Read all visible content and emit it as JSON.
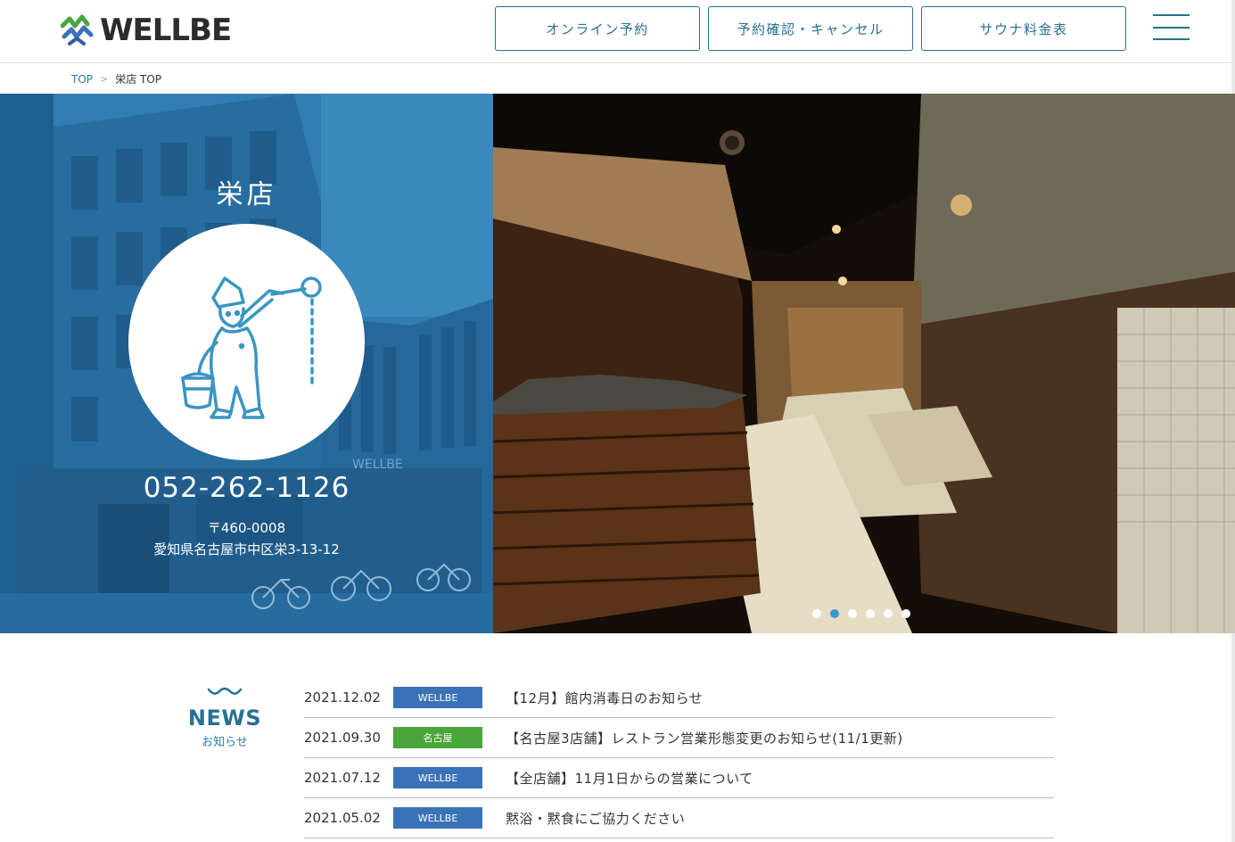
{
  "header": {
    "logo_text": "WELLBE",
    "buttons": [
      "オンライン予約",
      "予約確認・キャンセル",
      "サウナ料金表"
    ]
  },
  "breadcrumb": {
    "home": "TOP",
    "separator": ">",
    "current": "栄店 TOP"
  },
  "store": {
    "name": "栄店",
    "phone": "052-262-1126",
    "postal": "〒460-0008",
    "address": "愛知県名古屋市中区栄3-13-12",
    "building_sign": "WELLBE"
  },
  "slider": {
    "dot_count": 6,
    "active_index": 1
  },
  "news": {
    "title": "NEWS",
    "subtitle": "お知らせ",
    "items": [
      {
        "date": "2021.12.02",
        "tag": "WELLBE",
        "tag_type": "wellbe",
        "text": "【12月】館内消毒日のお知らせ"
      },
      {
        "date": "2021.09.30",
        "tag": "名古屋",
        "tag_type": "nagoya",
        "text": "【名古屋3店舗】レストラン営業形態変更のお知らせ(11/1更新)"
      },
      {
        "date": "2021.07.12",
        "tag": "WELLBE",
        "tag_type": "wellbe",
        "text": "【全店舗】11月1日からの営業について"
      },
      {
        "date": "2021.05.02",
        "tag": "WELLBE",
        "tag_type": "wellbe",
        "text": "黙浴・黙食にご協力ください"
      }
    ]
  },
  "colors": {
    "accent": "#2a6f8f",
    "tag_wellbe": "#3a72b8",
    "tag_nagoya": "#4aa53a",
    "dot_active": "#3d9ac9"
  }
}
